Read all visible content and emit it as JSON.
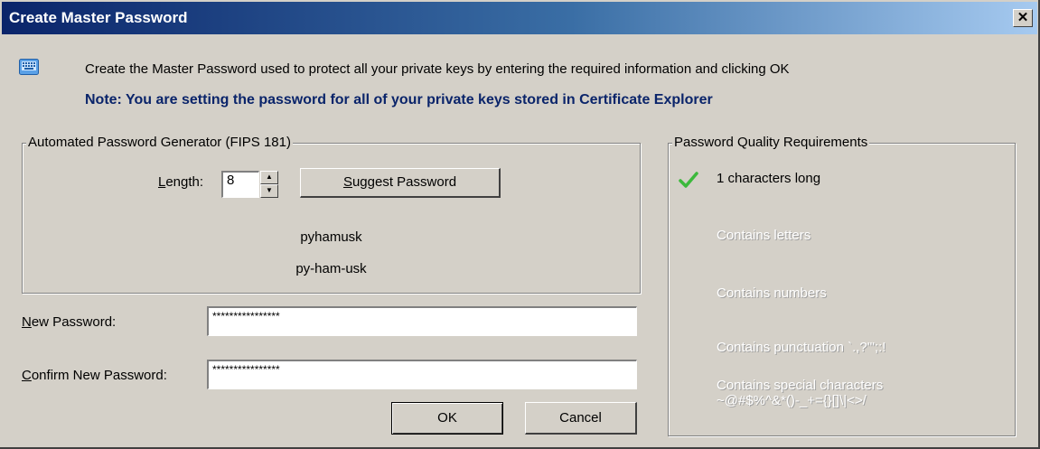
{
  "window": {
    "title": "Create Master Password",
    "close_glyph": "✕"
  },
  "header": {
    "icon": "keyboard-icon",
    "intro": "Create the Master Password used to protect all your private keys by entering the required information and clicking OK",
    "note": "Note: You are setting the password for all of your private keys stored in Certificate Explorer"
  },
  "generator": {
    "legend": "Automated Password Generator (FIPS 181)",
    "length_label_first": "L",
    "length_label_rest": "ength:",
    "length_value": "8",
    "spin_up": "▲",
    "spin_down": "▼",
    "suggest_first": "S",
    "suggest_rest": "uggest Password",
    "generated": "pyhamusk",
    "generated_hyphenated": "py-ham-usk"
  },
  "fields": {
    "new_label_first": "N",
    "new_label_rest": "ew Password:",
    "new_value": "****************",
    "confirm_label_first": "C",
    "confirm_label_rest": "onfirm New Password:",
    "confirm_value": "****************"
  },
  "requirements": {
    "legend": "Password Quality Requirements",
    "items": [
      {
        "label": "1 characters long",
        "met": true
      },
      {
        "label": "Contains letters",
        "met": false
      },
      {
        "label": "Contains numbers",
        "met": false
      },
      {
        "label": "Contains punctuation `.,?'\";:!",
        "met": false
      },
      {
        "label": "Contains special characters",
        "met": false
      },
      {
        "label": "~@#$%^&*()-_+={}[]\\|<>/",
        "met": false
      }
    ]
  },
  "buttons": {
    "ok": "OK",
    "cancel": "Cancel"
  },
  "colors": {
    "title_start": "#0a246a",
    "title_end": "#a6caf0",
    "note": "#0a246a",
    "check": "#3cb93c",
    "face": "#d4d0c8"
  }
}
